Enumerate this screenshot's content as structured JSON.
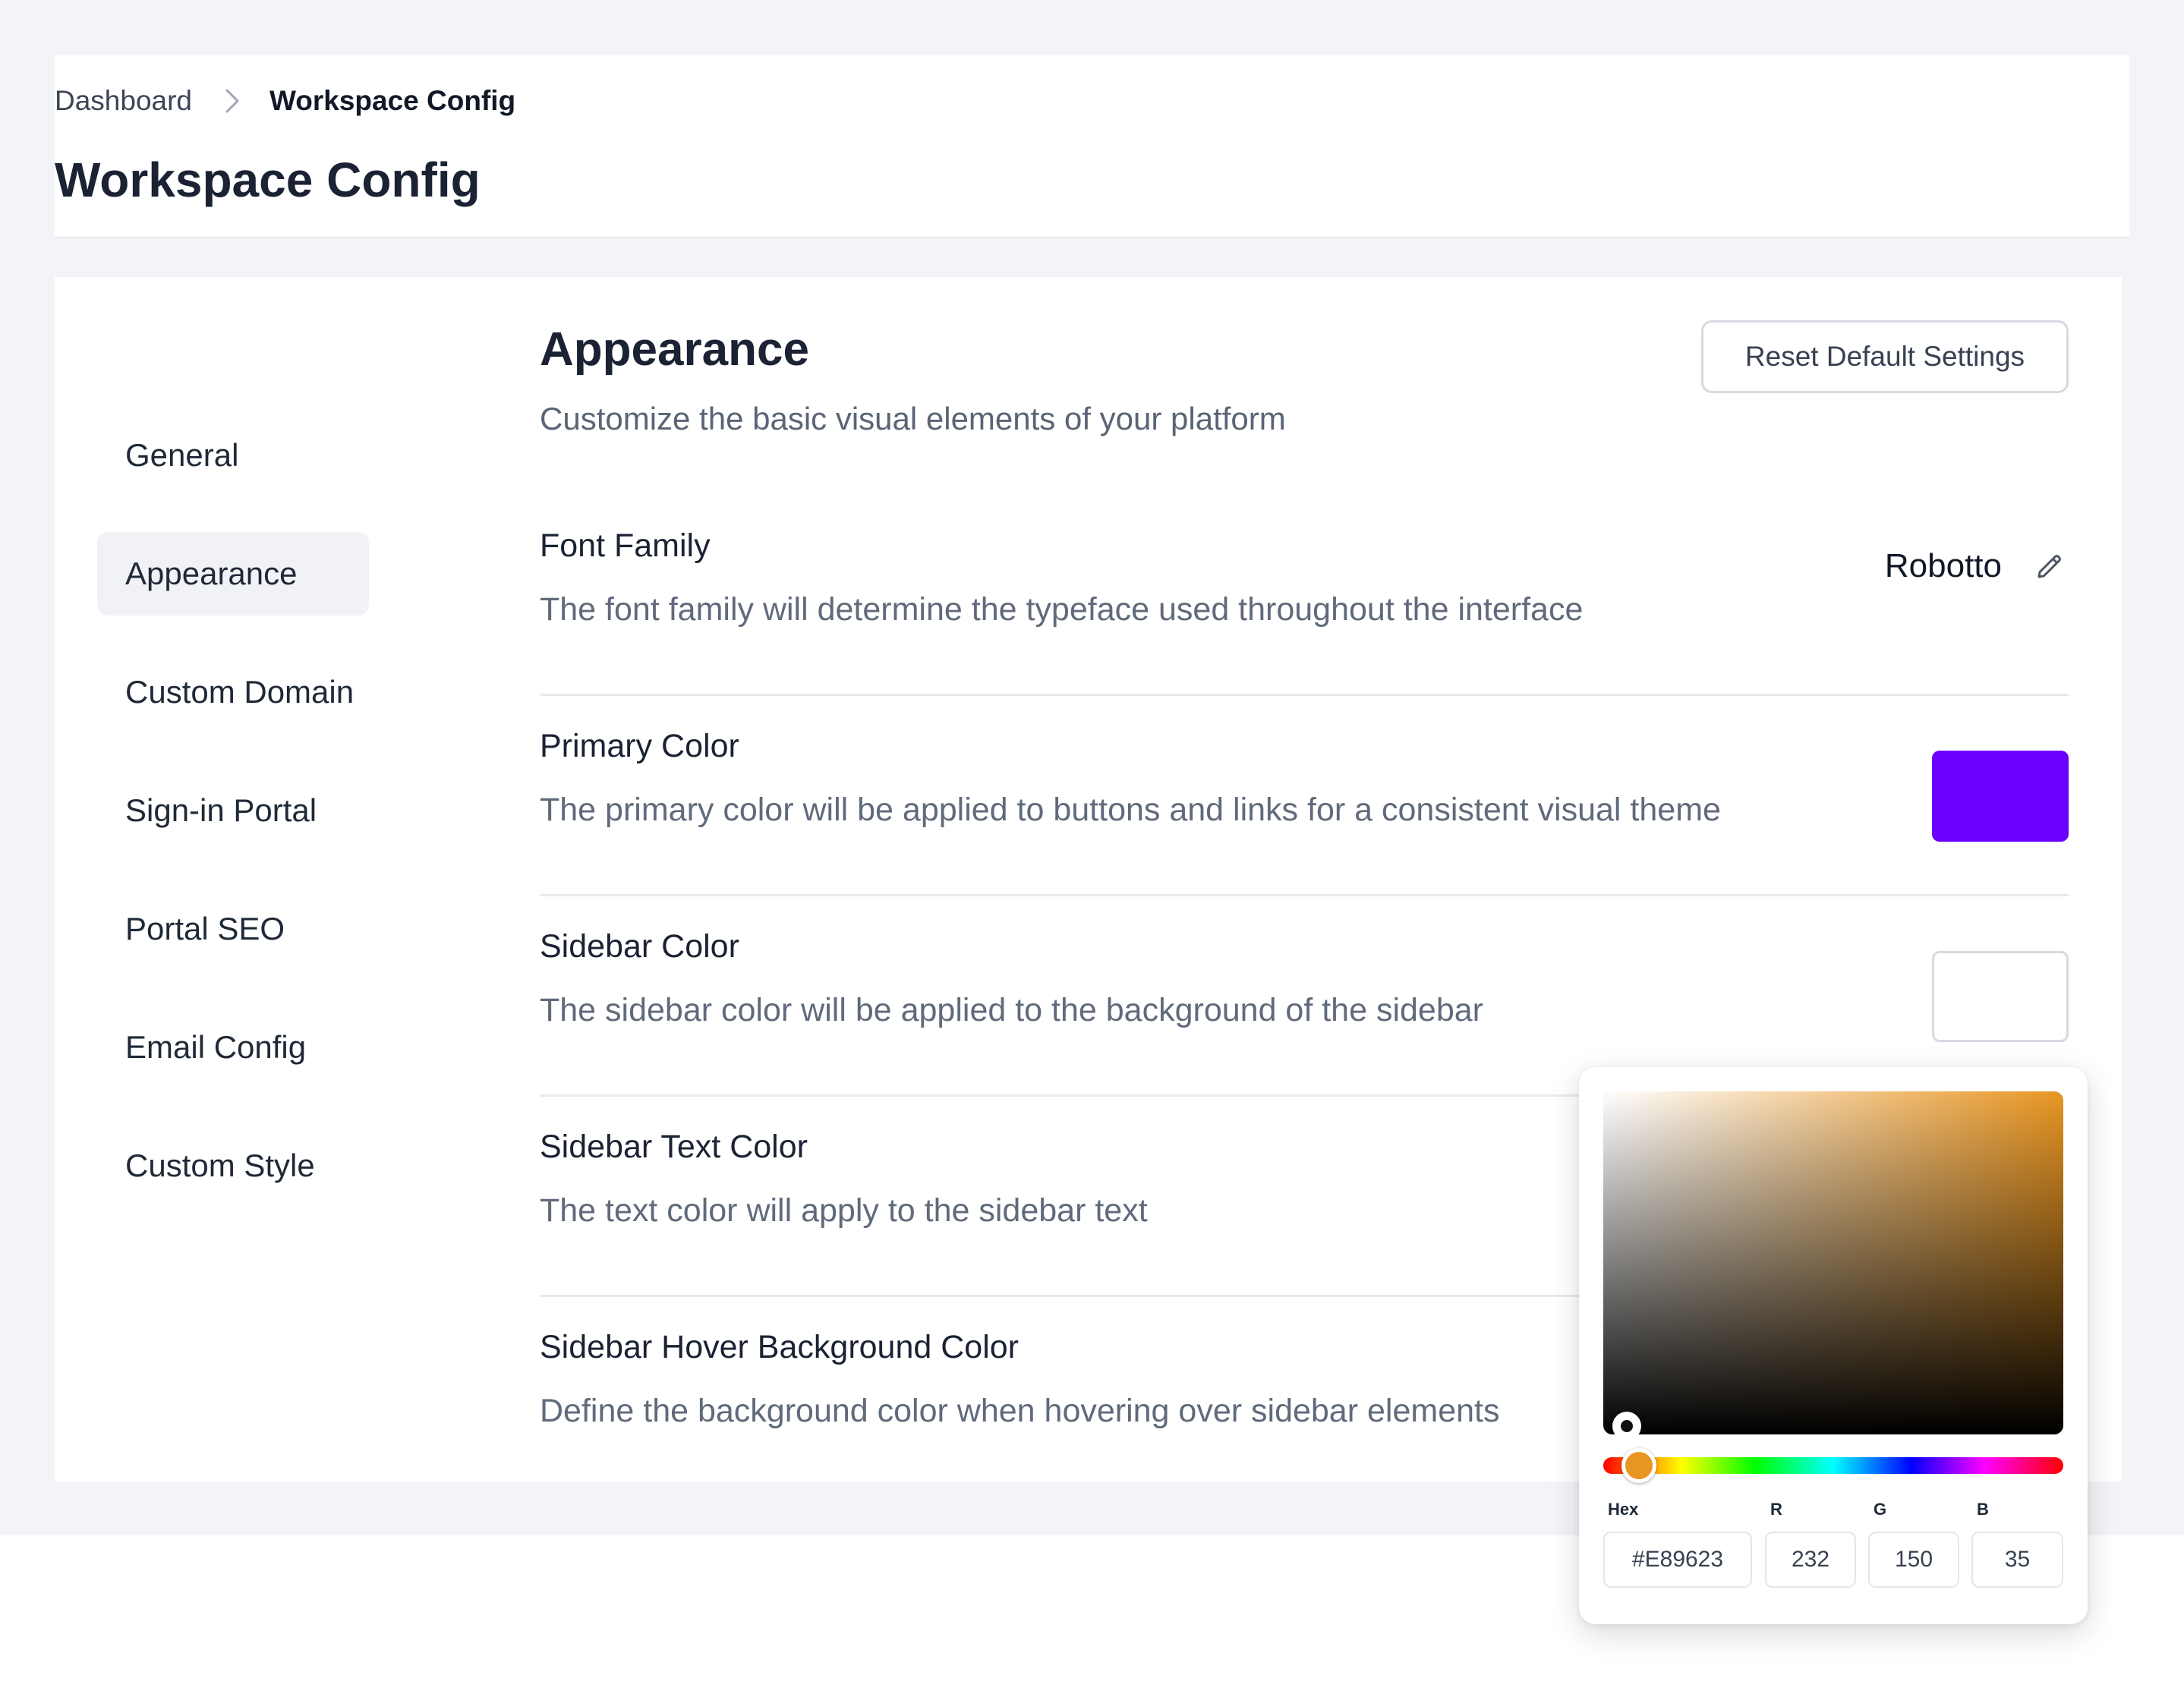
{
  "breadcrumb": {
    "parent": "Dashboard",
    "current": "Workspace Config"
  },
  "page_title": "Workspace Config",
  "sidebar": {
    "items": [
      {
        "label": "General",
        "active": false
      },
      {
        "label": "Appearance",
        "active": true
      },
      {
        "label": "Custom Domain",
        "active": false
      },
      {
        "label": "Sign-in Portal",
        "active": false
      },
      {
        "label": "Portal SEO",
        "active": false
      },
      {
        "label": "Email Config",
        "active": false
      },
      {
        "label": "Custom Style",
        "active": false
      }
    ]
  },
  "section": {
    "title": "Appearance",
    "subtitle": "Customize the basic visual elements of your platform",
    "reset_label": "Reset Default Settings"
  },
  "settings": [
    {
      "label": "Font Family",
      "description": "The font family will determine the typeface used throughout the interface",
      "value": "Robotto"
    },
    {
      "label": "Primary Color",
      "description": "The primary color will be applied to buttons and links for a consistent visual theme",
      "color": "#6b00ff"
    },
    {
      "label": "Sidebar Color",
      "description": "The sidebar color will be applied to the background of the sidebar",
      "color": "#ffffff"
    },
    {
      "label": "Sidebar Text Color",
      "description": "The text color will apply to the sidebar text"
    },
    {
      "label": "Sidebar Hover Background Color",
      "description": "Define the background color when hovering over sidebar elements"
    }
  ],
  "color_picker": {
    "hue_color": "#e89623",
    "labels": {
      "hex": "Hex",
      "r": "R",
      "g": "G",
      "b": "B"
    },
    "values": {
      "hex": "#E89623",
      "r": "232",
      "g": "150",
      "b": "35"
    }
  },
  "colors": {
    "page_background": "#f3f4f7",
    "card_background": "#ffffff",
    "active_item_background": "#f1f2f5",
    "divider": "#e8eaef"
  }
}
